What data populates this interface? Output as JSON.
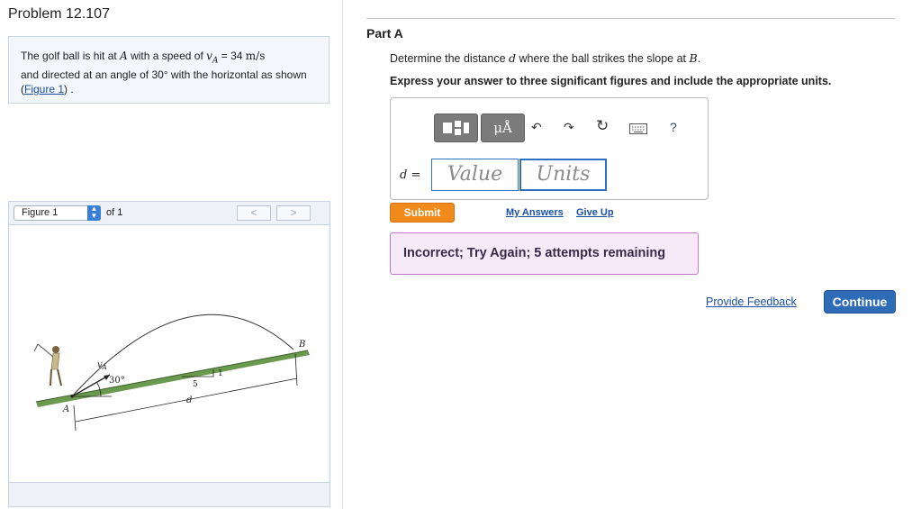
{
  "problem": {
    "title": "Problem 12.107",
    "text_1": "The golf ball is hit at ",
    "point_A": "A",
    "text_2": " with a speed of ",
    "speed_symbol": "v",
    "speed_sub": "A",
    "text_3": " = 34 ",
    "speed_unit": "m/s",
    "text_4": "and directed at an angle of 30° with the horizontal as shown (",
    "figure_link": "Figure 1",
    "text_5": ") ."
  },
  "figure": {
    "selector_value": "Figure 1",
    "of_label": "of 1",
    "prev_glyph": "<",
    "next_glyph": ">",
    "labels": {
      "vA_v": "v",
      "vA_sub": "A",
      "angle": "30°",
      "point_B": "B",
      "point_A": "A",
      "slope_run": "5",
      "slope_rise": "1",
      "distance": "d"
    }
  },
  "part": {
    "title": "Part A",
    "question_1": "Determine the distance ",
    "question_var": "d",
    "question_2": " where the ball strikes the slope at ",
    "question_point": "B",
    "question_3": ".",
    "instruction": "Express your answer to three significant figures and include the appropriate units."
  },
  "answer": {
    "label": "d =",
    "value_placeholder": "Value",
    "units_placeholder": "Units",
    "toolbar": {
      "templates_icon": "templates-icon",
      "units_btn_label": "μÅ",
      "undo_glyph": "↶",
      "redo_glyph": "↷",
      "reset_glyph": "↻",
      "keyboard_icon": "keyboard-icon",
      "help_label": "?"
    }
  },
  "actions": {
    "submit": "Submit",
    "my_answers": "My Answers",
    "give_up": "Give Up",
    "feedback_message": "Incorrect; Try Again; 5 attempts remaining",
    "provide_feedback": "Provide Feedback",
    "continue": "Continue"
  },
  "colors": {
    "submit": "#f08a1a",
    "continue": "#2f6cb8",
    "feedback_bg": "#f8e9f8",
    "feedback_border": "#c27ac9",
    "slope": "#6a9a4e",
    "link": "#1a4fa8"
  }
}
